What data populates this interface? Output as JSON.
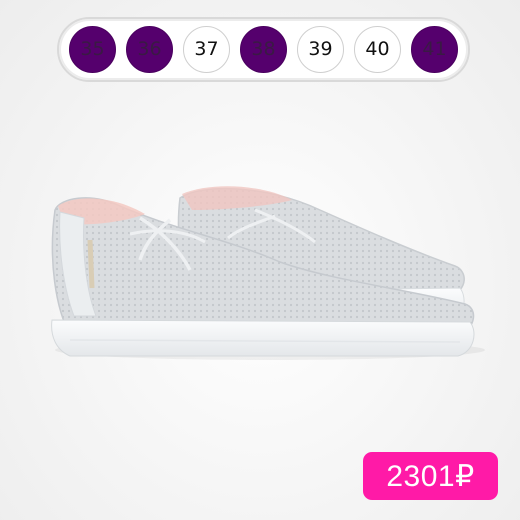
{
  "sizes": [
    {
      "label": "35",
      "available": false
    },
    {
      "label": "36",
      "available": false
    },
    {
      "label": "37",
      "available": true
    },
    {
      "label": "38",
      "available": false
    },
    {
      "label": "39",
      "available": true
    },
    {
      "label": "40",
      "available": true
    },
    {
      "label": "41",
      "available": false
    }
  ],
  "price": "2301₽",
  "colors": {
    "unavailable_size": "#55006d",
    "price_badge": "#ff1aa7",
    "shoe": "#dcdfe2"
  }
}
